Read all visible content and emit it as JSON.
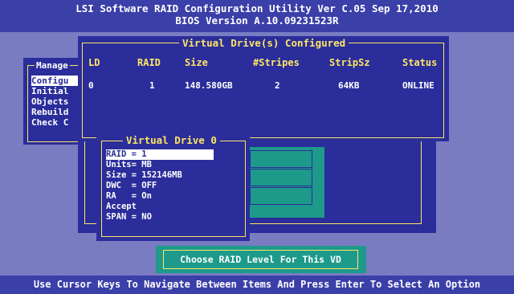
{
  "header": {
    "line1": "LSI Software RAID Configuration Utility Ver C.05 Sep 17,2010",
    "line2": "BIOS Version  A.10.09231523R"
  },
  "main_menu": {
    "title": "Manage",
    "items": [
      "Configu",
      "Initial",
      "Objects",
      "Rebuild",
      "Check C"
    ]
  },
  "vd_configured": {
    "title": "Virtual Drive(s) Configured",
    "columns": [
      "LD",
      "RAID",
      "Size",
      "#Stripes",
      "StripSz",
      "Status"
    ],
    "rows": [
      [
        "0",
        "1",
        "148.580GB",
        "2",
        "64KB",
        "ONLINE"
      ]
    ]
  },
  "virtual_drive": {
    "title": "Virtual Drive 0",
    "items": [
      "RAID = 1",
      "Units= MB",
      "Size = 152146MB",
      "DWC  = OFF",
      "RA   = On",
      "Accept",
      "SPAN = NO"
    ],
    "selected_index": 0
  },
  "help_box": {
    "text": "Choose RAID Level For This VD"
  },
  "footer": {
    "text": "Use Cursor Keys To Navigate Between Items And Press Enter To Select An Option"
  },
  "colors": {
    "background": "#7a7cc2",
    "panel": "#2a2d9a",
    "frame": "#ffe566",
    "header_bar": "#3b3fa8",
    "accent_green": "#1d9a8a"
  }
}
